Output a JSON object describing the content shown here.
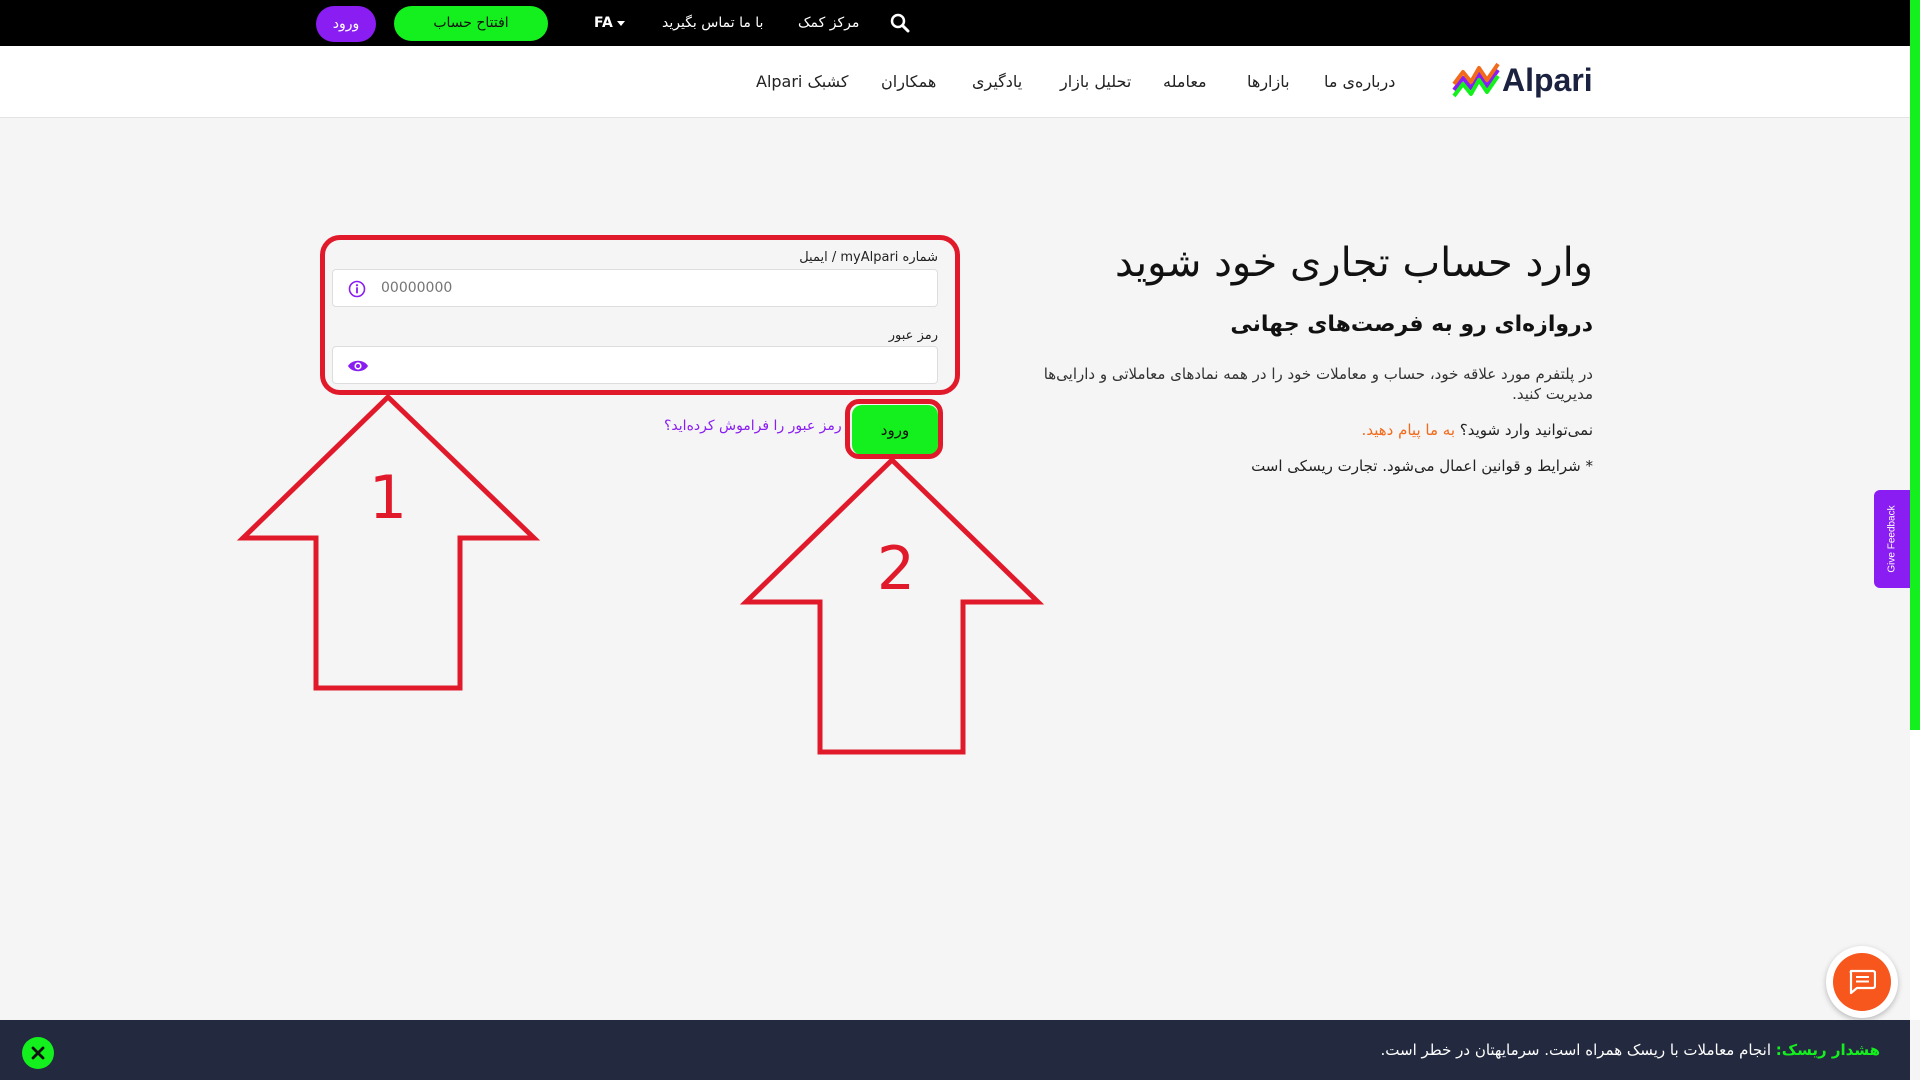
{
  "topbar": {
    "login_label": "ورود",
    "open_account_label": "افتتاح حساب",
    "language": "FA",
    "contact_label": "با ما تماس بگیرید",
    "help_center_label": "مرکز کمک"
  },
  "nav": {
    "brand": "Alpari",
    "items": [
      {
        "label": "درباره‌ی ما"
      },
      {
        "label": "بازارها"
      },
      {
        "label": "معامله"
      },
      {
        "label": "تحلیل بازار"
      },
      {
        "label": "یادگیری"
      },
      {
        "label": "همکاران"
      },
      {
        "label": "کشبک Alpari"
      }
    ]
  },
  "login_form": {
    "account_label": "شماره myAlpari / ایمیل",
    "account_placeholder": "00000000",
    "password_label": "رمز عبور",
    "password_value": "",
    "submit_label": "ورود",
    "forgot_password_label": "رمز عبور را فراموش کرده‌اید؟"
  },
  "annotations": {
    "arrow1_number": "1",
    "arrow2_number": "2",
    "color": "#e11a2b"
  },
  "content": {
    "headline": "وارد حساب تجاری خود شوید",
    "subheadline": "دروازه‌ای رو به فرصت‌های جهانی",
    "description": "در پلتفرم مورد علاقه خود، حساب و معاملات خود را در همه نمادهای معاملاتی و دارایی‌ها مدیریت کنید.",
    "cant_login_prefix": "نمی‌توانید وارد شوید؟",
    "cant_login_link": "به ما پیام دهید.",
    "terms_note": "* شرایط و قوانین اعمال می‌شود. تجارت ریسکی است"
  },
  "feedback": {
    "label": "Give Feedback"
  },
  "risk_warning": {
    "label": "هشدار ریسک:",
    "text": "انجام معاملات با ریسک همراه است. سرمایهتان در خطر است."
  },
  "colors": {
    "brand_green": "#14f01e",
    "brand_purple": "#8a1df2",
    "chat_orange": "#f7561c",
    "footer_navy": "#232a3f"
  },
  "icons": [
    "search-icon",
    "info-icon",
    "eye-icon",
    "chat-icon",
    "close-icon",
    "caret-down-icon"
  ]
}
